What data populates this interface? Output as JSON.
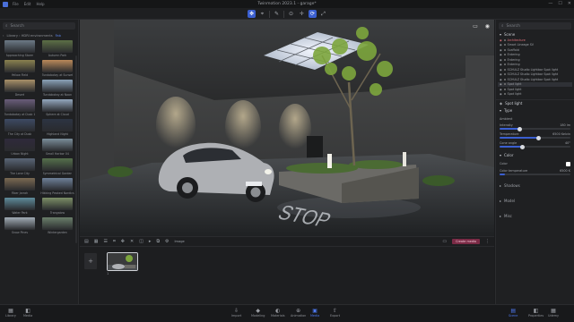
{
  "window": {
    "title": "Twinmotion 2023.1 - garage*",
    "menu": [
      "File",
      "Edit",
      "Help"
    ],
    "controls": [
      "—",
      "☐",
      "✕"
    ]
  },
  "toolbar": {
    "center_icons": [
      "navigate-icon",
      "select-icon",
      "eyedropper-icon",
      "focus-icon",
      "move-icon",
      "rotate-icon",
      "scale-icon"
    ]
  },
  "library": {
    "search_placeholder": "Search",
    "header": {
      "path": "Library › HDRI environments",
      "link": "Fab"
    },
    "items": [
      {
        "label": "Approaching Storm",
        "color": "#6c7a86"
      },
      {
        "label": "Autumn Park",
        "color": "#5c6f46"
      },
      {
        "label": "Yellow Field",
        "color": "#8a8150"
      },
      {
        "label": "Tundobotay at Sunset",
        "color": "#b9895a"
      },
      {
        "label": "Desert",
        "color": "#a99069"
      },
      {
        "label": "Tundobotay at Noon",
        "color": "#8aa2b8"
      },
      {
        "label": "Tundobotay at Dusk 1",
        "color": "#6a5d7a"
      },
      {
        "label": "Sphere at Cloud",
        "color": "#93a7bd"
      },
      {
        "label": "The City at Dusk",
        "color": "#3d4a64"
      },
      {
        "label": "Highland Night",
        "color": "#2c3443"
      },
      {
        "label": "Urban Night",
        "color": "#2f2a3c"
      },
      {
        "label": "Small Harbor 04",
        "color": "#7b8d9a"
      },
      {
        "label": "The Lone City",
        "color": "#5a6677"
      },
      {
        "label": "Symmetrical Garden",
        "color": "#55704c"
      },
      {
        "label": "Fiber Jarrah",
        "color": "#7b6a52"
      },
      {
        "label": "Hikking Peaked Nordics",
        "color": "#6e8098"
      },
      {
        "label": "Water Park",
        "color": "#5f8c9c"
      },
      {
        "label": "Trangalow",
        "color": "#7c8f67"
      },
      {
        "label": "Snow Pines",
        "color": "#a2adb6"
      },
      {
        "label": "Wintergarden",
        "color": "#6b7f6b"
      }
    ]
  },
  "viewport": {
    "icons": [
      "screen-icon",
      "eye-icon"
    ]
  },
  "timeline": {
    "tools": [
      "layout-icon",
      "grid-icon",
      "list-icon",
      "crop-icon",
      "move-icon",
      "close-icon",
      "camera-icon",
      "play-icon",
      "copy-icon",
      "settings-icon"
    ],
    "label": "Image",
    "create_label": "Create media",
    "clip_number": "1"
  },
  "scene": {
    "title": "Scene",
    "search_placeholder": "Search",
    "rows": [
      {
        "label": "Architecture",
        "highlight": true,
        "selected": false
      },
      {
        "label": "Smart Lineage SV",
        "highlight": false,
        "selected": false
      },
      {
        "label": "Scaffold",
        "highlight": false,
        "selected": false
      },
      {
        "label": "Entering",
        "highlight": false,
        "selected": false
      },
      {
        "label": "Entering",
        "highlight": false,
        "selected": false
      },
      {
        "label": "Entering",
        "highlight": false,
        "selected": false
      },
      {
        "label": "SCHULZ Studio Lightbar Spot light",
        "highlight": false,
        "selected": false
      },
      {
        "label": "SCHULZ Studio Lightbar Spot light",
        "highlight": false,
        "selected": false
      },
      {
        "label": "SCHULZ Studio Lightbar Spot light",
        "highlight": false,
        "selected": false
      },
      {
        "label": "Spot light",
        "highlight": false,
        "selected": true
      },
      {
        "label": "Spot light",
        "highlight": false,
        "selected": false
      },
      {
        "label": "Spot light",
        "highlight": false,
        "selected": false
      }
    ]
  },
  "properties": {
    "title": "Spot light",
    "section": "Type",
    "subsection": "Ambient",
    "sliders": [
      {
        "label": "Intensity",
        "value": "180 lm",
        "fraction": 0.28
      },
      {
        "label": "Temperature",
        "value": "6500 Kelvin",
        "fraction": 0.55
      },
      {
        "label": "Cone angle",
        "value": "40°",
        "fraction": 0.32
      }
    ],
    "color_label": "Color",
    "color_value": "Color",
    "lumen_label": "Color temperature",
    "lumen_value": "6500 K",
    "groups": [
      "Shadows",
      "Model",
      "Misc"
    ]
  },
  "bottom": {
    "center": [
      {
        "label": "Import",
        "icon": "⇩"
      },
      {
        "label": "Modeling",
        "icon": "◆"
      },
      {
        "label": "Materials",
        "icon": "◐"
      },
      {
        "label": "Animation",
        "icon": "⊕"
      },
      {
        "label": "Media",
        "icon": "▣",
        "active": true
      },
      {
        "label": "Export",
        "icon": "⇧"
      }
    ],
    "right": [
      {
        "label": "Scene",
        "icon": "▤",
        "active": true
      },
      {
        "label": "Properties",
        "icon": "◧",
        "active": false
      },
      {
        "label": "Udemy",
        "icon": "▦",
        "active": false
      }
    ],
    "left": [
      {
        "label": "Library",
        "icon": "▦"
      },
      {
        "label": "Media",
        "icon": "◧"
      }
    ]
  },
  "colors": {
    "accent": "#3b5fd0",
    "create": "#7a2a45",
    "highlight": "#e0707a"
  }
}
